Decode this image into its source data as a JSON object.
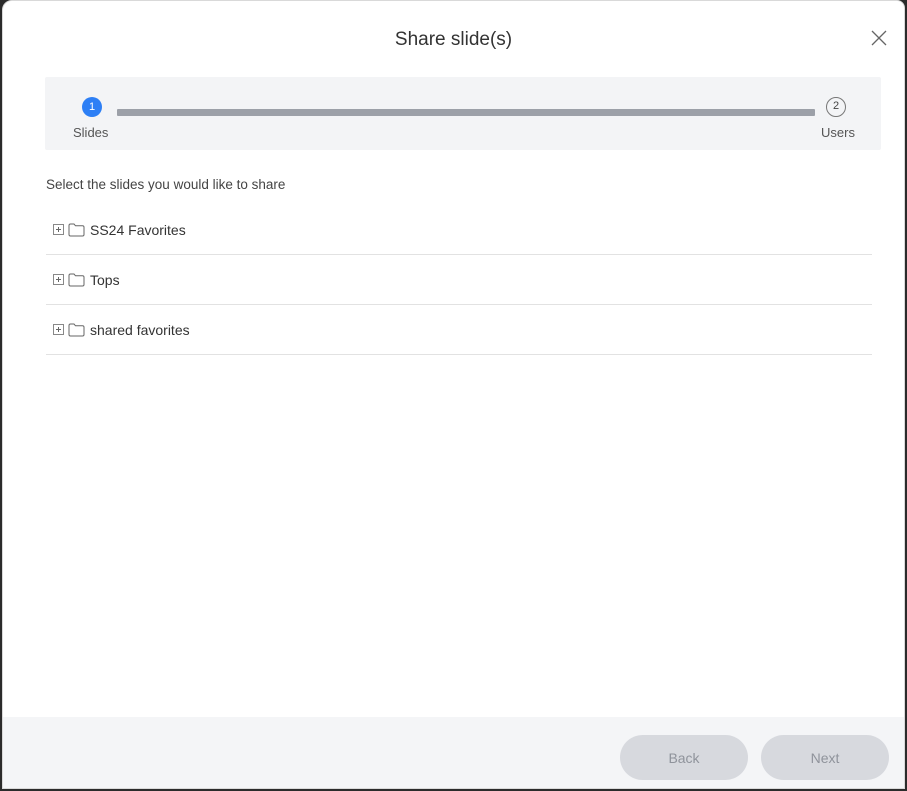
{
  "dialog": {
    "title": "Share slide(s)",
    "close_icon": "close-icon"
  },
  "stepper": {
    "current_step": 1,
    "steps": [
      {
        "number": "1",
        "label": "Slides",
        "active": true
      },
      {
        "number": "2",
        "label": "Users",
        "active": false
      }
    ],
    "colors": {
      "active": "#2d7ff5",
      "bar": "#9ca0a8"
    }
  },
  "instruction": "Select the slides you would like to share",
  "folders": [
    {
      "label": "SS24 Favorites",
      "expand_icon": "plus-box-icon",
      "icon": "folder-icon"
    },
    {
      "label": "Tops",
      "expand_icon": "plus-box-icon",
      "icon": "folder-icon"
    },
    {
      "label": "shared favorites",
      "expand_icon": "plus-box-icon",
      "icon": "folder-icon"
    }
  ],
  "footer": {
    "back_label": "Back",
    "next_label": "Next",
    "back_enabled": false,
    "next_enabled": false
  }
}
